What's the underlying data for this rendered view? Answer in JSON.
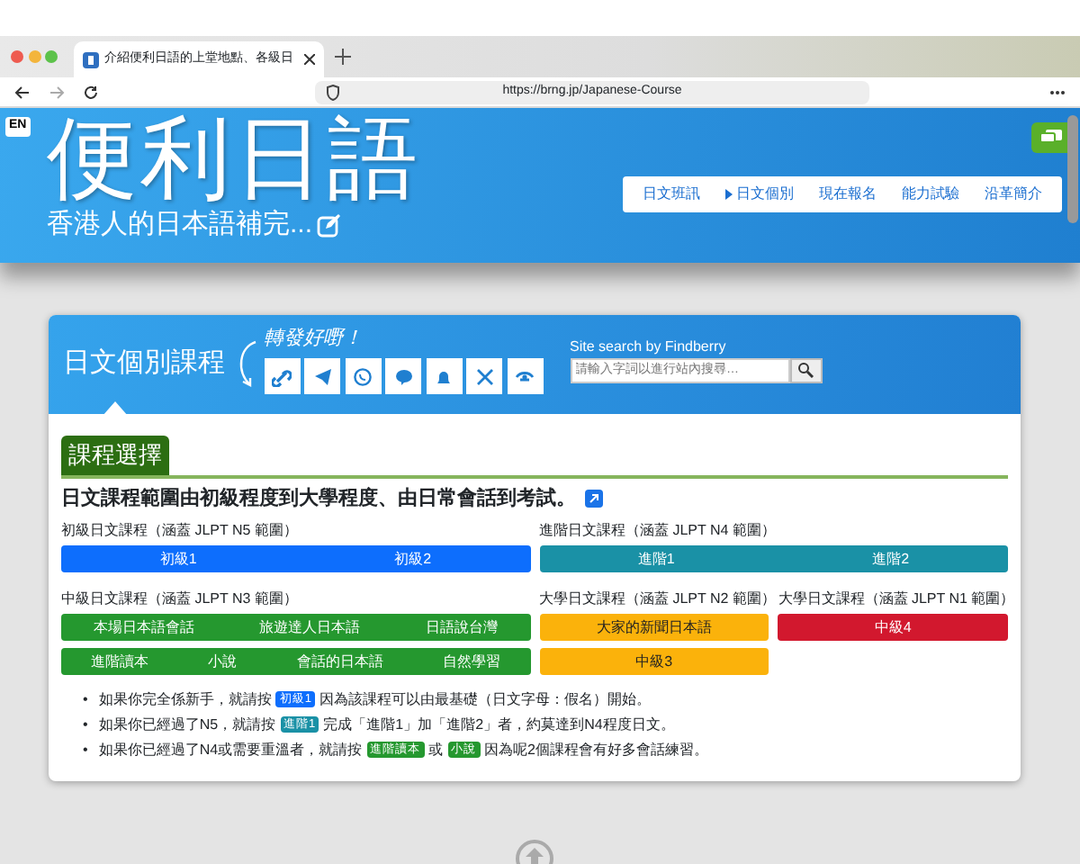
{
  "browser": {
    "tab_title": "介紹便利日語的上堂地點、各級日",
    "url": "https://brng.jp/Japanese-Course"
  },
  "header": {
    "lang_badge": "EN",
    "logo": "便利日語",
    "tagline": "香港人的日本語補完...",
    "nav": [
      {
        "label": "日文班訊",
        "selected": false
      },
      {
        "label": "日文個別",
        "selected": true
      },
      {
        "label": "現在報名",
        "selected": false
      },
      {
        "label": "能力試驗",
        "selected": false
      },
      {
        "label": "沿革簡介",
        "selected": false
      }
    ]
  },
  "card": {
    "title": "日文個別課程",
    "share_label": "轉發好嘢！",
    "search": {
      "label": "Site search by Findberry",
      "placeholder": "請輸入字詞以進行站內搜尋…"
    }
  },
  "section_title": "課程選擇",
  "intro": "日文課程範圍由初級程度到大學程度、由日常會話到考試。",
  "course_groups": [
    {
      "label": "初級日文課程（涵蓋 JLPT N5 範圍）",
      "color": "#0d6efd",
      "rows": [
        {
          "links": [
            "初級1",
            "初級2"
          ]
        }
      ]
    },
    {
      "label": "進階日文課程（涵蓋 JLPT N4 範圍）",
      "color": "#1a91a6",
      "rows": [
        {
          "links": [
            "進階1",
            "進階2"
          ]
        }
      ]
    },
    {
      "label": "中級日文課程（涵蓋 JLPT N3 範圍）",
      "color": "#25982f",
      "rows": [
        {
          "links": [
            "本場日本語會話",
            "旅遊達人日本語",
            "日語說台灣"
          ]
        },
        {
          "links": [
            "進階讀本",
            "小說",
            "會話的日本語",
            "自然學習"
          ]
        }
      ]
    },
    {
      "label": "大學日文課程（涵蓋 JLPT N2 範圍）",
      "color": "#fbb20b",
      "rows": [
        {
          "links": [
            "大家的新聞日本語"
          ]
        },
        {
          "links": [
            "中級3"
          ]
        }
      ]
    },
    {
      "label": "大學日文課程（涵蓋 JLPT N1 範圍）",
      "color": "#d2182e",
      "rows": [
        {
          "links": [
            "中級4"
          ]
        }
      ]
    }
  ],
  "notes": [
    {
      "marker": "•",
      "parts": [
        {
          "text": "如果你完全係新手，就請按"
        },
        {
          "badge": "初級1",
          "color": "#0d6efd"
        },
        {
          "text": "因為該課程可以由最基礎（日文字母：假名）開始。"
        }
      ]
    },
    {
      "marker": "•",
      "parts": [
        {
          "text": "如果你已經過了N5，就請按"
        },
        {
          "badge": "進階1",
          "color": "#1a91a6"
        },
        {
          "text": "完成「進階1」加「進階2」者，約莫達到N4程度日文。"
        }
      ]
    },
    {
      "marker": "•",
      "parts": [
        {
          "text": "如果你已經過了N4或需要重溫者，就請按"
        },
        {
          "badge": "進階讀本",
          "color": "#25982f"
        },
        {
          "text": "或"
        },
        {
          "badge": "小說",
          "color": "#25982f"
        },
        {
          "text": "因為呢2個課程會有好多會話練習。"
        }
      ]
    }
  ]
}
